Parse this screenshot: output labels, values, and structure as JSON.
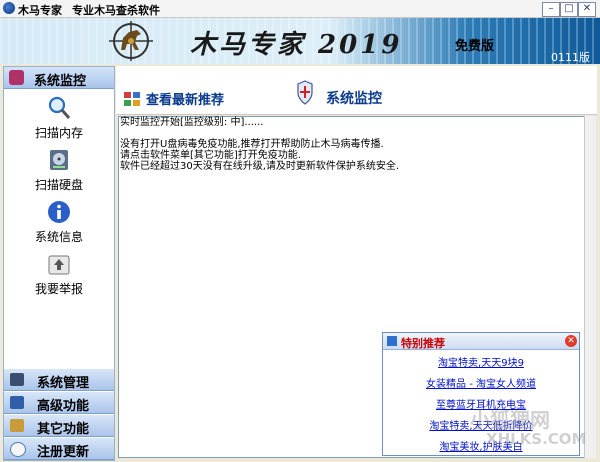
{
  "titlebar": {
    "app_name": "木马专家",
    "subtitle": "专业木马查杀软件",
    "btn_minimize": "–",
    "btn_maximize": "□",
    "btn_close": "✕"
  },
  "banner": {
    "title": "木马专家 2019",
    "edition": "免费版",
    "version": "0111版"
  },
  "sidebar": {
    "header": "系统监控",
    "items": [
      {
        "label": "扫描内存",
        "icon": "magnifier-icon"
      },
      {
        "label": "扫描硬盘",
        "icon": "harddisk-icon"
      },
      {
        "label": "系统信息",
        "icon": "info-icon"
      },
      {
        "label": "我要举报",
        "icon": "report-icon"
      }
    ],
    "nav": [
      {
        "label": "系统管理",
        "icon": "system-manage-icon"
      },
      {
        "label": "高级功能",
        "icon": "advanced-icon"
      },
      {
        "label": "其它功能",
        "icon": "tools-icon"
      },
      {
        "label": "注册更新",
        "icon": "register-icon"
      }
    ]
  },
  "content": {
    "latest_link": "查看最新推荐",
    "section_title": "系统监控",
    "log": [
      "实时监控开始[监控级别: 中]......",
      "",
      "没有打开U盘病毒免疫功能,推荐打开帮助防止木马病毒传播.",
      "请点击软件菜单[其它功能]打开免疫功能.",
      "软件已经超过30天没有在线升级,请及时更新软件保护系统安全."
    ]
  },
  "popup": {
    "title": "特别推荐",
    "close": "✕",
    "links": [
      "淘宝特卖,天天9块9",
      "女装精品 - 淘宝女人频道",
      "至尊蓝牙耳机充电宝",
      "淘宝特卖,天天低折降价",
      "淘宝美妆,护肤美白"
    ]
  },
  "watermark": {
    "text": "小狐狸网",
    "url": "XHLKS.COM"
  },
  "colors": {
    "link": "#0b3b8c",
    "popup_title": "#cc0000",
    "popup_link": "#0010c8"
  }
}
